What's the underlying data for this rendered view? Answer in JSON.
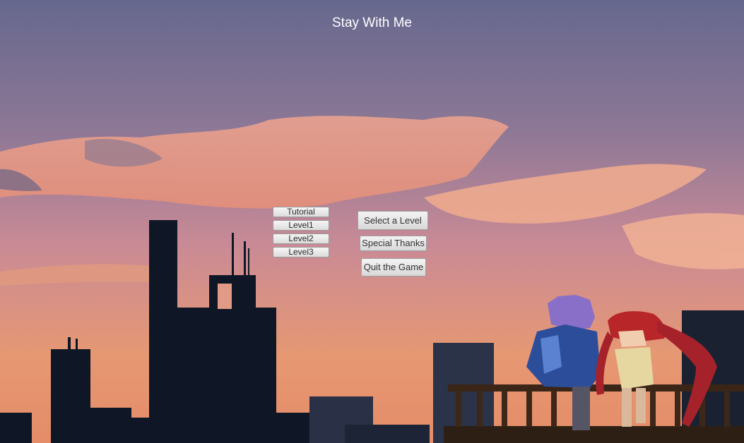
{
  "title": "Stay With Me",
  "level_menu": {
    "items": [
      {
        "label": "Tutorial"
      },
      {
        "label": "Level1"
      },
      {
        "label": "Level2"
      },
      {
        "label": "Level3"
      }
    ]
  },
  "main_menu": {
    "select_level_label": "Select a Level",
    "special_thanks_label": "Special Thanks",
    "quit_label": "Quit the Game"
  },
  "colors": {
    "sky_top": "#6f6a8e",
    "sky_mid": "#c9889a",
    "sky_bottom": "#e79a70",
    "silhouette": "#101826",
    "button_face": "#e8e8e8"
  }
}
